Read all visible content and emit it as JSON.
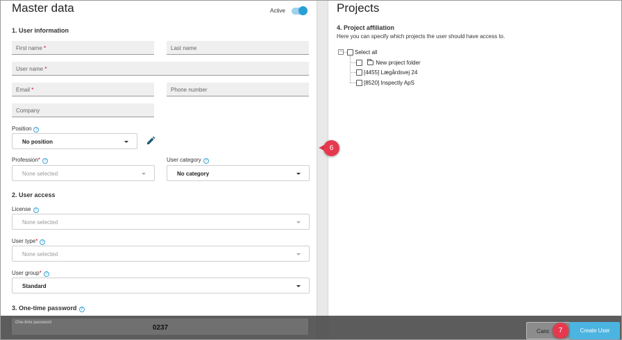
{
  "master": {
    "title": "Master data",
    "active_label": "Active",
    "active_on": true,
    "section1": "1. User information",
    "first_name": "First name",
    "last_name": "Last name",
    "user_name": "User name",
    "email": "Email",
    "phone": "Phone number",
    "company": "Company",
    "required_mark": "*",
    "position_label": "Position",
    "position_value": "No position",
    "profession_label": "Profession",
    "profession_value": "None selected",
    "user_category_label": "User category",
    "user_category_value": "No category",
    "section2": "2. User access",
    "license_label": "License",
    "license_value": "None selected",
    "user_type_label": "User type",
    "user_type_value": "None selected",
    "user_group_label": "User group",
    "user_group_value": "Standard",
    "section3": "3. One-time password",
    "otp_label": "One-time password",
    "otp_value": "0237",
    "help_glyph": "?"
  },
  "projects": {
    "title": "Projects",
    "section4": "4. Project affiliation",
    "description": "Here you can specify which projects the user should have access to.",
    "expander_glyph": "−",
    "select_all": "Select all",
    "items": [
      {
        "label": "New project folder",
        "icon": "folder-icon"
      },
      {
        "label": "[4455] Lægårdsvej 24"
      },
      {
        "label": "[8520] Inspectly ApS"
      }
    ]
  },
  "footer": {
    "cancel": "Cancel",
    "cancel_visible": "Canc",
    "create": "Create User"
  },
  "callouts": {
    "six": "6",
    "seven": "7"
  },
  "colors": {
    "accent": "#2a9fd6",
    "primary_button": "#4bb4e1",
    "callout": "#e6394f",
    "required": "#d0021b"
  }
}
